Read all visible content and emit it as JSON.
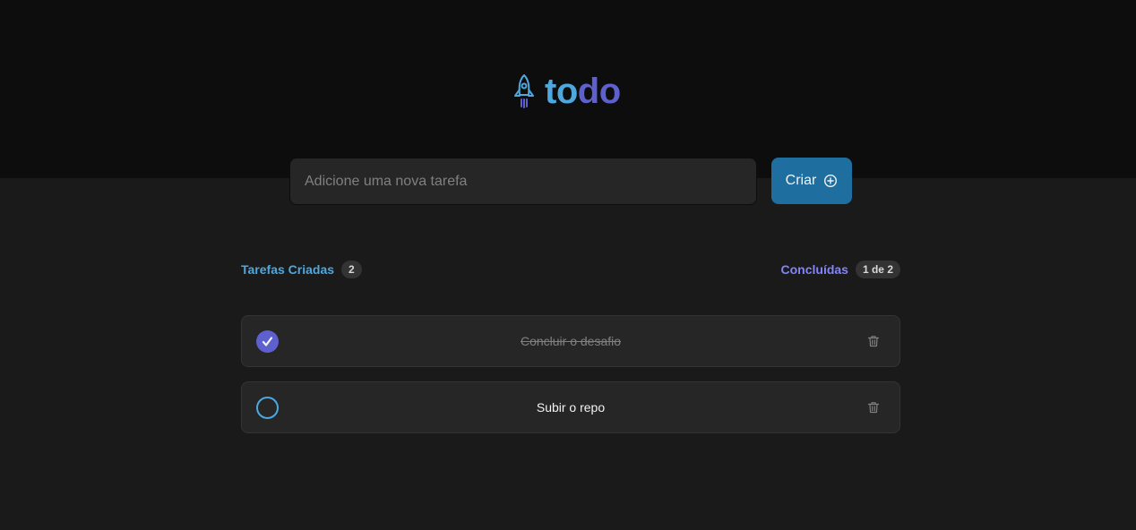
{
  "header": {
    "logo_icon": "rocket-icon",
    "logo_part_1": "to",
    "logo_part_2": "do",
    "colors": {
      "blue": "#4ea8de",
      "purple": "#5e60ce"
    }
  },
  "new_task": {
    "placeholder": "Adicione uma nova tarefa",
    "value": ""
  },
  "create_button": {
    "label": "Criar",
    "icon": "plus-circle-icon"
  },
  "summary": {
    "created_label": "Tarefas Criadas",
    "created_count": "2",
    "done_label": "Concluídas",
    "done_count": "1 de 2"
  },
  "tasks": [
    {
      "text": "Concluir o desafio",
      "completed": true,
      "icon": "check-icon",
      "delete_icon": "trash-icon"
    },
    {
      "text": "Subir o repo",
      "completed": false,
      "delete_icon": "trash-icon"
    }
  ]
}
